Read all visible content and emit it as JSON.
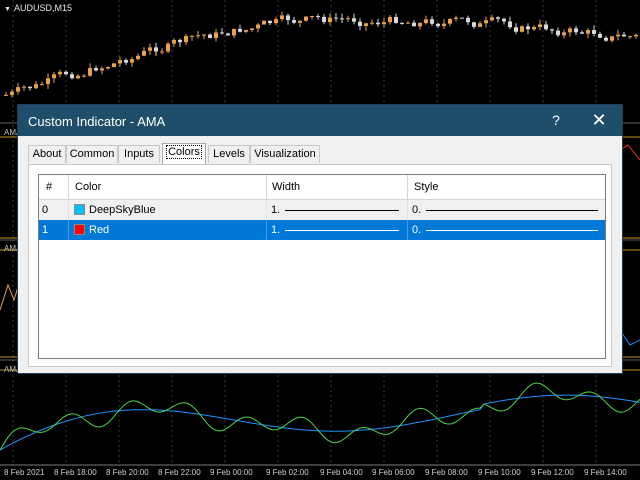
{
  "chart": {
    "symbol": "AUDUSD,M15",
    "subwindow_labels": [
      "AMA",
      "AMA",
      "AMA"
    ],
    "time_labels": [
      "8 Feb 2021",
      "8 Feb 18:00",
      "8 Feb 20:00",
      "8 Feb 22:00",
      "9 Feb 00:00",
      "9 Feb 02:00",
      "9 Feb 04:00",
      "9 Feb 06:00",
      "9 Feb 08:00",
      "9 Feb 10:00",
      "9 Feb 12:00",
      "9 Feb 14:00"
    ],
    "colors": {
      "background": "#000000",
      "bull": "#e8a050",
      "bear": "#d8d8d8",
      "line_blue": "#1e90ff",
      "line_green": "#4cd44c",
      "grid": "#3a3a3a",
      "level": "#c89020"
    }
  },
  "dialog": {
    "title": "Custom Indicator - AMA",
    "help_label": "?",
    "close_label": "✕",
    "tabs": [
      {
        "label": "About"
      },
      {
        "label": "Common"
      },
      {
        "label": "Inputs"
      },
      {
        "label": "Colors"
      },
      {
        "label": "Levels"
      },
      {
        "label": "Visualization"
      }
    ],
    "active_tab": "Colors",
    "table": {
      "headers": [
        "#",
        "Color",
        "Width",
        "Style"
      ],
      "rows": [
        {
          "index": "0",
          "color_name": "DeepSkyBlue",
          "swatch": "#00bfff",
          "width": "1.",
          "style": "0."
        },
        {
          "index": "1",
          "color_name": "Red",
          "swatch": "#ff0000",
          "width": "1.",
          "style": "0.",
          "selected": true
        }
      ]
    }
  }
}
